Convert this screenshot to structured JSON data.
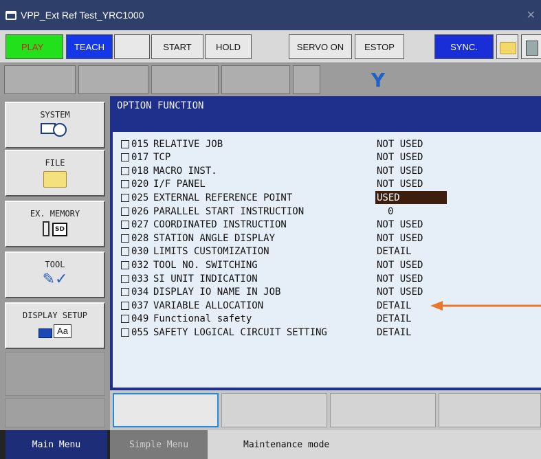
{
  "window": {
    "title": "VPP_Ext Ref Test_YRC1000",
    "close_glyph": "✕"
  },
  "toolbar": {
    "play": "PLAY",
    "teach": "TEACH",
    "start": "START",
    "hold": "HOLD",
    "servo_on": "SERVO ON",
    "estop": "ESTOP",
    "sync": "SYNC.",
    "icons": [
      "folder-icon",
      "calculator-icon"
    ]
  },
  "function_keys": {
    "axis_label": "Y"
  },
  "left_menu": {
    "items": [
      {
        "label": "SYSTEM",
        "icon": "system-clock-icon"
      },
      {
        "label": "FILE",
        "icon": "folder-icon"
      },
      {
        "label": "EX. MEMORY",
        "icon": "sd-card-icon"
      },
      {
        "label": "TOOL",
        "icon": "tool-icon"
      },
      {
        "label": "DISPLAY SETUP",
        "icon": "display-setup-icon"
      }
    ],
    "sd_text": "SD",
    "aa_text": "Aa"
  },
  "panel": {
    "title": "OPTION FUNCTION",
    "options": [
      {
        "num": "015",
        "name": "RELATIVE JOB",
        "value": "NOT USED"
      },
      {
        "num": "017",
        "name": "TCP",
        "value": "NOT USED"
      },
      {
        "num": "018",
        "name": "MACRO INST.",
        "value": "NOT USED"
      },
      {
        "num": "020",
        "name": "I/F PANEL",
        "value": "NOT USED"
      },
      {
        "num": "025",
        "name": "EXTERNAL REFERENCE POINT",
        "value": "USED",
        "highlighted": true
      },
      {
        "num": "026",
        "name": "PARALLEL START INSTRUCTION",
        "value": "0"
      },
      {
        "num": "027",
        "name": "COORDINATED INSTRUCTION",
        "value": "NOT USED"
      },
      {
        "num": "028",
        "name": "STATION ANGLE DISPLAY",
        "value": "NOT USED"
      },
      {
        "num": "030",
        "name": "LIMITS CUSTOMIZATION",
        "value": "DETAIL"
      },
      {
        "num": "032",
        "name": "TOOL NO. SWITCHING",
        "value": "NOT USED"
      },
      {
        "num": "033",
        "name": "SI UNIT INDICATION",
        "value": "NOT USED"
      },
      {
        "num": "034",
        "name": "DISPLAY IO NAME IN JOB",
        "value": "NOT USED"
      },
      {
        "num": "037",
        "name": "VARIABLE ALLOCATION",
        "value": "DETAIL"
      },
      {
        "num": "049",
        "name": "Functional safety",
        "value": "DETAIL"
      },
      {
        "num": "055",
        "name": "SAFETY LOGICAL CIRCUIT SETTING",
        "value": "DETAIL"
      }
    ],
    "highlight_color": "#3d1d0e",
    "arrow_color": "#e8782a"
  },
  "bottom": {
    "main_menu": "Main Menu",
    "simple_menu": "Simple Menu",
    "status": "Maintenance mode"
  }
}
